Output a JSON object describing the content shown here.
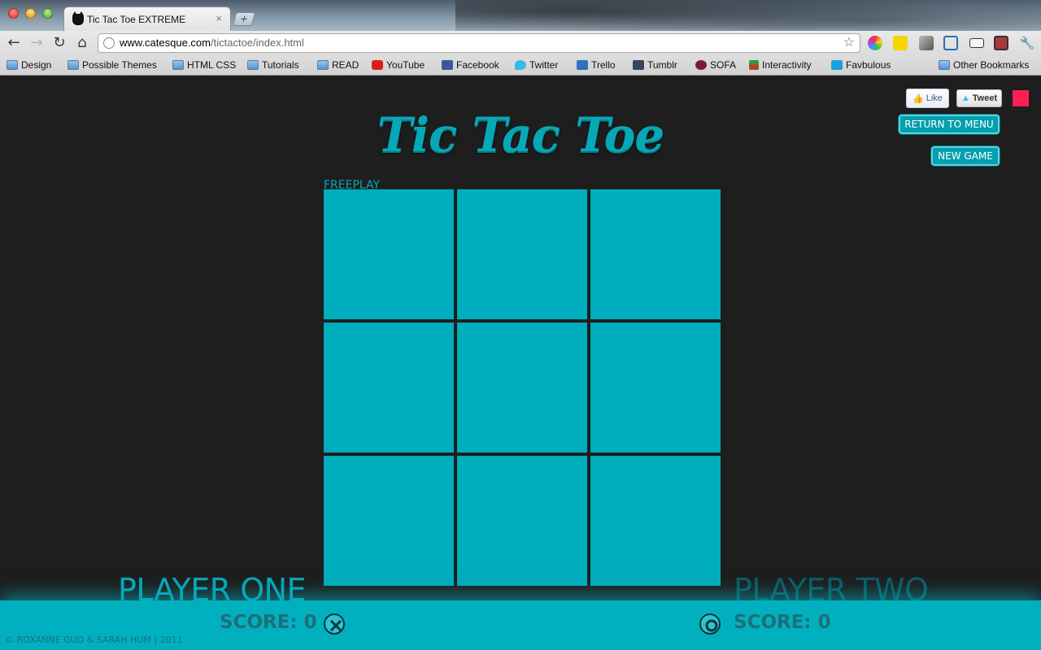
{
  "browser": {
    "tab_title": "Tic Tac Toe EXTREME",
    "tab_close": "×",
    "new_tab": "+",
    "url_host": "www.catesque.com",
    "url_path": "/tictactoe/index.html",
    "bookmarks": [
      "Design",
      "Possible Themes",
      "HTML CSS",
      "Tutorials",
      "READ",
      "YouTube",
      "Facebook",
      "Twitter",
      "Trello",
      "Tumblr",
      "SOFA",
      "Interactivity",
      "Favbulous",
      "Other Bookmarks"
    ]
  },
  "game": {
    "title": "Tic Tac Toe",
    "mode": "FREEPLAY",
    "like_label": "Like",
    "tweet_label": "Tweet",
    "return_button": "RETURN TO MENU",
    "new_game_button": "NEW GAME",
    "board": [
      "",
      "",
      "",
      "",
      "",
      "",
      "",
      "",
      ""
    ],
    "player_one": {
      "name": "PLAYER ONE",
      "score_text": "SCORE: 0",
      "mark": "x-icon"
    },
    "player_two": {
      "name": "PLAYER TWO",
      "score_text": "SCORE: 0",
      "mark": "o-icon"
    },
    "credits": "© ROXANNE GUO & SARAH HUM | 2011",
    "colors": {
      "accent": "#00adbc",
      "background": "#1e1e1e",
      "pink": "#ff1f55"
    }
  }
}
